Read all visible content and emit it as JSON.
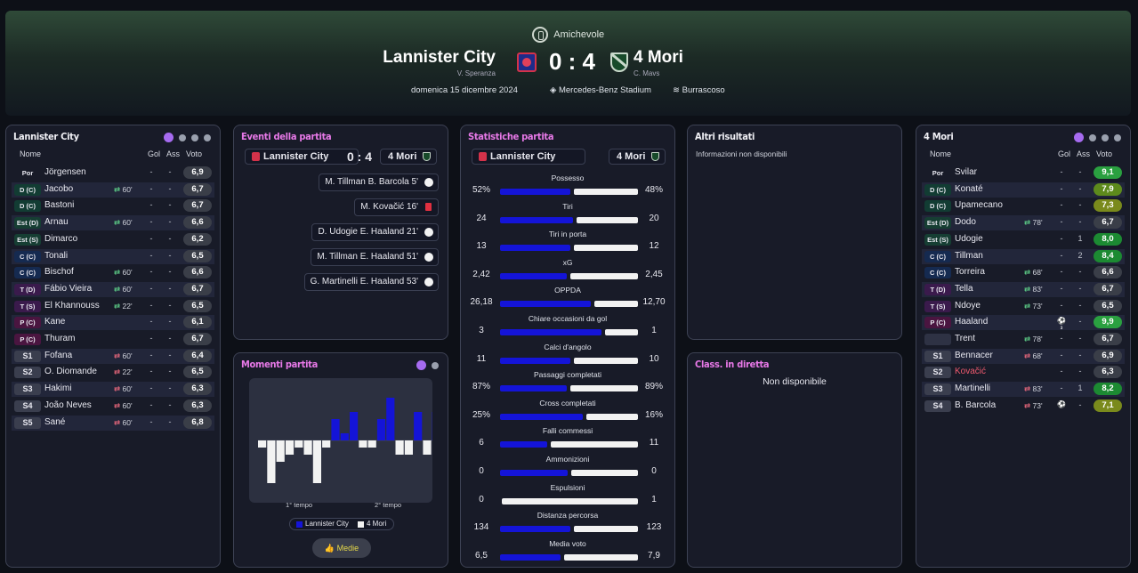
{
  "match": {
    "competition": "Amichevole",
    "home_team": "Lannister City",
    "home_coach": "V. Speranza",
    "away_team": "4 Mori",
    "away_coach": "C. Mavs",
    "score": "0 : 4",
    "date": "domenica 15 dicembre 2024",
    "stadium": "Mercedes-Benz Stadium",
    "weather": "Burrascoso"
  },
  "home_lineup": {
    "title": "Lannister City",
    "headers": {
      "name": "Nome",
      "goals": "Gol",
      "assists": "Ass",
      "rating": "Voto"
    },
    "players": [
      {
        "pos": "Por",
        "name": "Jörgensen",
        "sub": "",
        "g": "-",
        "a": "-",
        "r": "6,9"
      },
      {
        "pos": "D (C)",
        "name": "Jacobo",
        "sub": "60'",
        "g": "-",
        "a": "-",
        "r": "6,7"
      },
      {
        "pos": "D (C)",
        "name": "Bastoni",
        "sub": "",
        "g": "-",
        "a": "-",
        "r": "6,7"
      },
      {
        "pos": "Est (D)",
        "name": "Arnau",
        "sub": "60'",
        "g": "-",
        "a": "-",
        "r": "6,6"
      },
      {
        "pos": "Est (S)",
        "name": "Dimarco",
        "sub": "",
        "g": "-",
        "a": "-",
        "r": "6,2"
      },
      {
        "pos": "C (C)",
        "name": "Tonali",
        "sub": "",
        "g": "-",
        "a": "-",
        "r": "6,5"
      },
      {
        "pos": "C (C)",
        "name": "Bischof",
        "sub": "60'",
        "g": "-",
        "a": "-",
        "r": "6,6"
      },
      {
        "pos": "T (D)",
        "name": "Fábio Vieira",
        "sub": "60'",
        "g": "-",
        "a": "-",
        "r": "6,7"
      },
      {
        "pos": "T (S)",
        "name": "El Khannouss",
        "sub": "22'",
        "g": "-",
        "a": "-",
        "r": "6,5"
      },
      {
        "pos": "P (C)",
        "name": "Kane",
        "sub": "",
        "g": "-",
        "a": "-",
        "r": "6,1"
      },
      {
        "pos": "P (C)",
        "name": "Thuram",
        "sub": "",
        "g": "-",
        "a": "-",
        "r": "6,7"
      },
      {
        "pos": "S1",
        "name": "Fofana",
        "sub": "60'",
        "g": "-",
        "a": "-",
        "r": "6,4"
      },
      {
        "pos": "S2",
        "name": "O. Diomande",
        "sub": "22'",
        "g": "-",
        "a": "-",
        "r": "6,5"
      },
      {
        "pos": "S3",
        "name": "Hakimi",
        "sub": "60'",
        "g": "-",
        "a": "-",
        "r": "6,3"
      },
      {
        "pos": "S4",
        "name": "João Neves",
        "sub": "60'",
        "g": "-",
        "a": "-",
        "r": "6,3"
      },
      {
        "pos": "S5",
        "name": "Sané",
        "sub": "60'",
        "g": "-",
        "a": "-",
        "r": "6,8"
      }
    ]
  },
  "away_lineup": {
    "title": "4 Mori",
    "headers": {
      "name": "Nome",
      "goals": "Gol",
      "assists": "Ass",
      "rating": "Voto"
    },
    "players": [
      {
        "pos": "Por",
        "name": "Svilar",
        "sub": "",
        "g": "-",
        "a": "-",
        "r": "9,1"
      },
      {
        "pos": "D (C)",
        "name": "Konaté",
        "sub": "",
        "g": "-",
        "a": "-",
        "r": "7,9"
      },
      {
        "pos": "D (C)",
        "name": "Upamecano",
        "sub": "",
        "g": "-",
        "a": "-",
        "r": "7,3"
      },
      {
        "pos": "Est (D)",
        "name": "Dodo",
        "sub": "78'",
        "g": "-",
        "a": "-",
        "r": "6,7"
      },
      {
        "pos": "Est (S)",
        "name": "Udogie",
        "sub": "",
        "g": "-",
        "a": "1",
        "r": "8,0"
      },
      {
        "pos": "C (C)",
        "name": "Tillman",
        "sub": "",
        "g": "-",
        "a": "2",
        "r": "8,4"
      },
      {
        "pos": "C (C)",
        "name": "Torreira",
        "sub": "68'",
        "g": "-",
        "a": "-",
        "r": "6,6"
      },
      {
        "pos": "T (D)",
        "name": "Tella",
        "sub": "83'",
        "g": "-",
        "a": "-",
        "r": "6,7"
      },
      {
        "pos": "T (S)",
        "name": "Ndoye",
        "sub": "73'",
        "g": "-",
        "a": "-",
        "r": "6,5"
      },
      {
        "pos": "P (C)",
        "name": "Haaland",
        "sub": "",
        "g": "goals",
        "a": "-",
        "r": "9,9"
      },
      {
        "pos": "",
        "name": "Trent",
        "sub": "78'",
        "g": "-",
        "a": "-",
        "r": "6,7"
      },
      {
        "pos": "S1",
        "name": "Bennacer",
        "sub": "68'",
        "g": "-",
        "a": "-",
        "r": "6,9"
      },
      {
        "pos": "S2",
        "name": "Kovačić",
        "sub": "",
        "g": "-",
        "a": "-",
        "r": "6,3"
      },
      {
        "pos": "S3",
        "name": "Martinelli",
        "sub": "83'",
        "g": "-",
        "a": "1",
        "r": "8,2"
      },
      {
        "pos": "S4",
        "name": "B. Barcola",
        "sub": "73'",
        "g": "goal",
        "a": "-",
        "r": "7,1"
      }
    ]
  },
  "events": {
    "title": "Eventi della partita",
    "home": "Lannister City",
    "score": "0 : 4",
    "away": "4 Mori",
    "items": [
      {
        "text": "M. Tillman  B. Barcola 5'",
        "type": "goal"
      },
      {
        "text": "M. Kovačić 16'",
        "type": "card"
      },
      {
        "text": "D. Udogie  E. Haaland 21'",
        "type": "goal"
      },
      {
        "text": "M. Tillman  E. Haaland 51'",
        "type": "goal"
      },
      {
        "text": "G. Martinelli  E. Haaland 53'",
        "type": "goal"
      }
    ]
  },
  "moments": {
    "title": "Momenti partita",
    "first_half": "1° tempo",
    "second_half": "2° tempo",
    "legend_home": "Lannister City",
    "legend_away": "4 Mori",
    "button": "Medie"
  },
  "chart_data": {
    "type": "bar",
    "title": "Momenti partita",
    "series": [
      {
        "name": "Lannister City",
        "values": [
          0,
          0,
          0,
          0,
          0,
          0,
          0,
          0,
          3,
          1,
          4,
          0,
          0,
          3,
          6,
          0,
          0,
          4,
          0,
          4
        ]
      },
      {
        "name": "4 Mori",
        "values": [
          1,
          6,
          3,
          2,
          1,
          2,
          6,
          1,
          0,
          0,
          0,
          1,
          1,
          0,
          0,
          2,
          2,
          0,
          2,
          0
        ]
      }
    ],
    "xlabel": "",
    "ylabel": ""
  },
  "stats": {
    "title": "Statistiche partita",
    "home": "Lannister City",
    "away": "4 Mori",
    "rows": [
      {
        "label": "Possesso",
        "home": "52%",
        "away": "48%",
        "hf": 0.52
      },
      {
        "label": "Tiri",
        "home": "24",
        "away": "20",
        "hf": 0.545
      },
      {
        "label": "Tiri in porta",
        "home": "13",
        "away": "12",
        "hf": 0.52
      },
      {
        "label": "xG",
        "home": "2,42",
        "away": "2,45",
        "hf": 0.497
      },
      {
        "label": "OPPDA",
        "home": "26,18",
        "away": "12,70",
        "hf": 0.673
      },
      {
        "label": "Chiare occasioni da gol",
        "home": "3",
        "away": "1",
        "hf": 0.75
      },
      {
        "label": "Calci d'angolo",
        "home": "11",
        "away": "10",
        "hf": 0.524
      },
      {
        "label": "Passaggi completati",
        "home": "87%",
        "away": "89%",
        "hf": 0.494
      },
      {
        "label": "Cross completati",
        "home": "25%",
        "away": "16%",
        "hf": 0.61
      },
      {
        "label": "Falli commessi",
        "home": "6",
        "away": "11",
        "hf": 0.353
      },
      {
        "label": "Ammonizioni",
        "home": "0",
        "away": "0",
        "hf": 0.5
      },
      {
        "label": "Espulsioni",
        "home": "0",
        "away": "1",
        "hf": 0.0
      },
      {
        "label": "Distanza percorsa",
        "home": "134",
        "away": "123",
        "hf": 0.521
      },
      {
        "label": "Media voto",
        "home": "6,5",
        "away": "7,9",
        "hf": 0.451
      }
    ]
  },
  "other_results": {
    "title": "Altri risultati",
    "text": "Informazioni non disponibili"
  },
  "live_table": {
    "title": "Class. in diretta",
    "text": "Non disponibile"
  }
}
